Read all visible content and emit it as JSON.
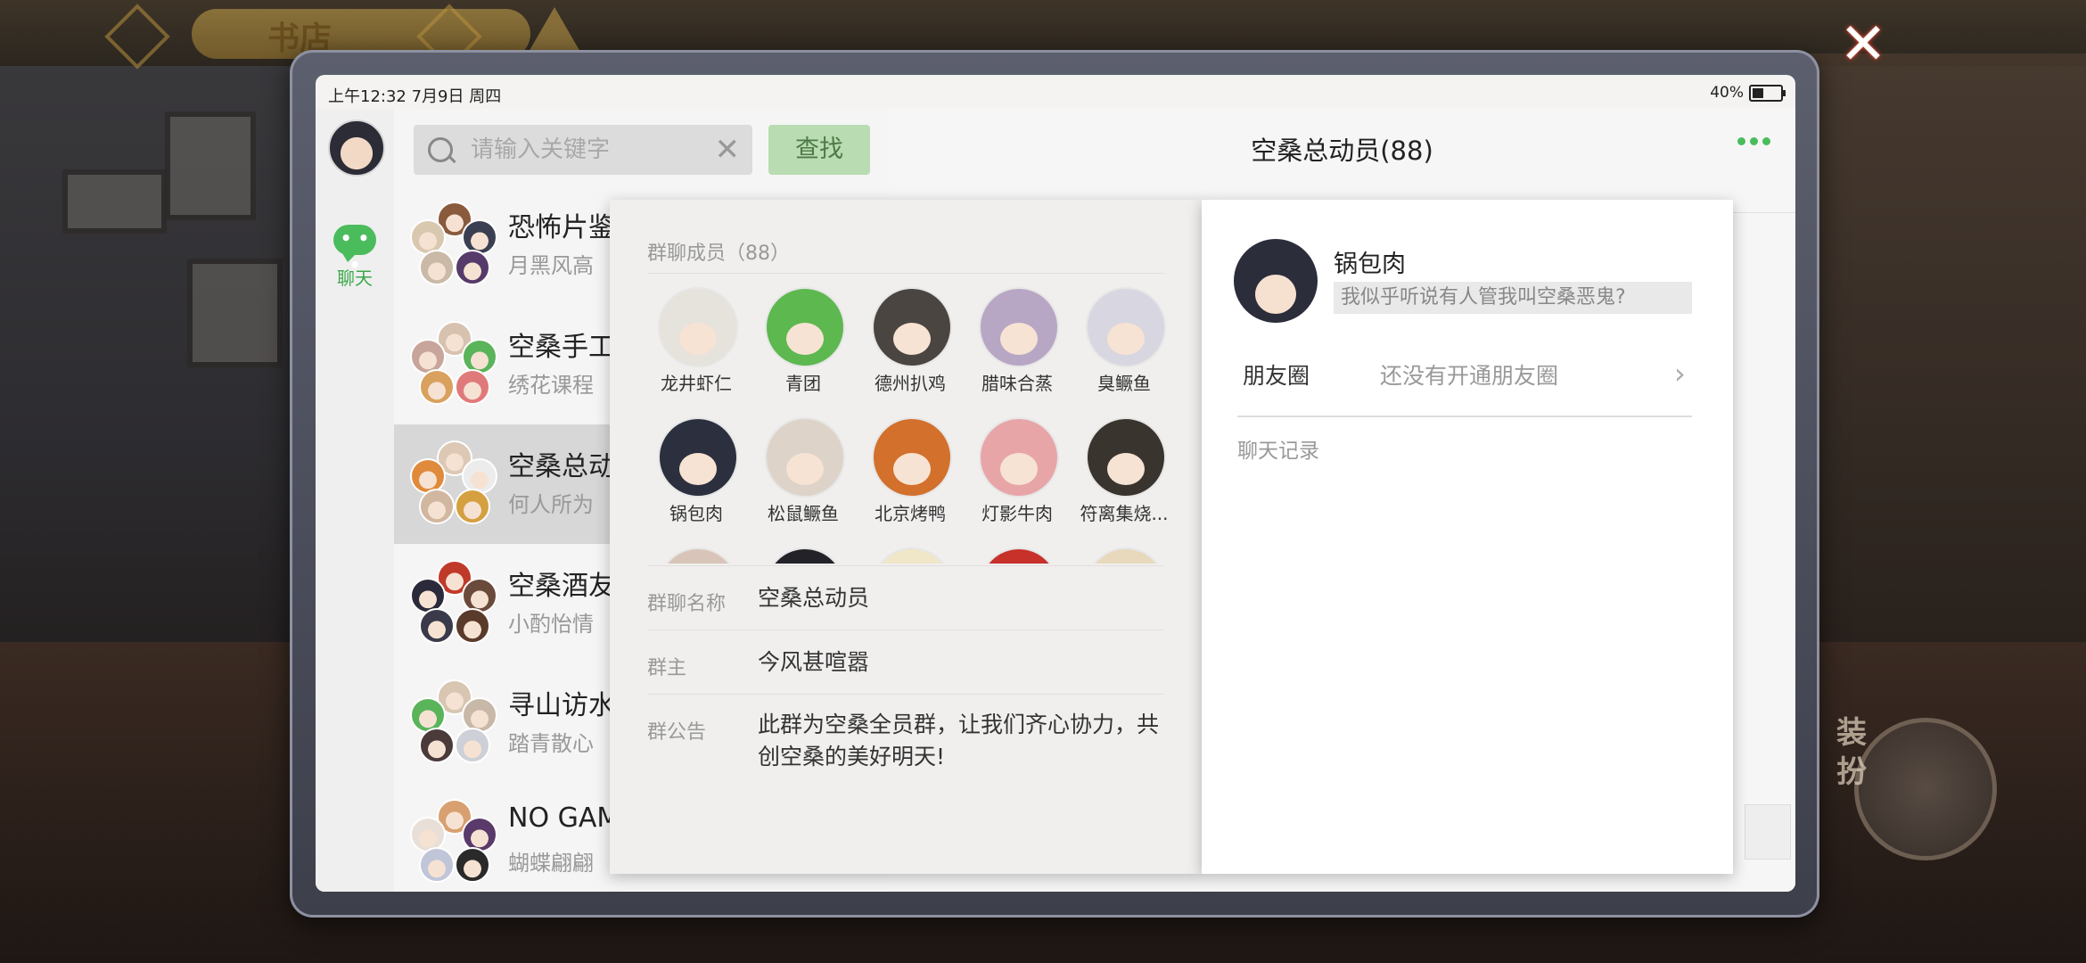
{
  "background": {
    "top_title": "书店",
    "dress_label": "装扮",
    "close_icon": "close-x-icon"
  },
  "status_bar": {
    "time": "上午12:32 7月9日 周四",
    "battery": "40%"
  },
  "rail": {
    "chat_label": "聊天",
    "chat_icon": "speech-bubble-icon"
  },
  "search": {
    "placeholder": "请输入关键字",
    "button": "查找"
  },
  "chat_list": [
    {
      "name": "恐怖片鉴",
      "sub": "月黑风高",
      "colors": [
        "#8a5a3c",
        "#d9c8b0",
        "#3b3f52",
        "#c9b9a6",
        "#553a6a"
      ]
    },
    {
      "name": "空桑手工",
      "sub": "绣花课程",
      "colors": [
        "#d7c2b0",
        "#c8a59b",
        "#5ab45a",
        "#d9a15e",
        "#e07a7a"
      ]
    },
    {
      "name": "空桑总动",
      "sub": "何人所为",
      "colors": [
        "#dcc8b4",
        "#e08a3c",
        "#ececec",
        "#d2b7a0",
        "#d4a040"
      ]
    },
    {
      "name": "空桑酒友",
      "sub": "小酌怡情",
      "colors": [
        "#c03a2a",
        "#2a2a3a",
        "#6a4a3a",
        "#3a3a4a",
        "#5a3a2a"
      ]
    },
    {
      "name": "寻山访水",
      "sub": "踏青散心",
      "colors": [
        "#d8c6b2",
        "#5ab45a",
        "#c8b8a8",
        "#4a3a3a",
        "#ced0d8"
      ]
    },
    {
      "name": "NO GAM",
      "sub": "蝴蝶翩翩",
      "colors": [
        "#d8a070",
        "#e8e0d8",
        "#5a3a6a",
        "#c0c6d8",
        "#2a2a2a"
      ]
    }
  ],
  "chat": {
    "title": "空桑总动员(88)",
    "more_icon": "more-dots-icon"
  },
  "group_info": {
    "members_title": "群聊成员（88）",
    "members": [
      {
        "name": "龙井虾仁",
        "color": "#e6e2dc"
      },
      {
        "name": "青团",
        "color": "#5db84f"
      },
      {
        "name": "德州扒鸡",
        "color": "#4a4540"
      },
      {
        "name": "腊味合蒸",
        "color": "#b7a6c4"
      },
      {
        "name": "臭鳜鱼",
        "color": "#d8d6e0"
      },
      {
        "name": "锅包肉",
        "color": "#2c2f3e"
      },
      {
        "name": "松鼠鳜鱼",
        "color": "#ddd3c8"
      },
      {
        "name": "北京烤鸭",
        "color": "#d2702c"
      },
      {
        "name": "灯影牛肉",
        "color": "#e8a5a8"
      },
      {
        "name": "符离集烧...",
        "color": "#3a342e"
      },
      {
        "name": "",
        "color": "#d8c4b8"
      },
      {
        "name": "",
        "color": "#222228"
      },
      {
        "name": "",
        "color": "#f0e6c8"
      },
      {
        "name": "",
        "color": "#c8302a"
      },
      {
        "name": "",
        "color": "#e8d8bc"
      }
    ],
    "name_label": "群聊名称",
    "name_value": "空桑总动员",
    "owner_label": "群主",
    "owner_value": "今风甚喧嚣",
    "notice_label": "群公告",
    "notice_value": "此群为空桑全员群，让我们齐心协力，共创空桑的美好明天!"
  },
  "profile": {
    "name": "锅包肉",
    "signature": "我似乎听说有人管我叫空桑恶鬼?",
    "moments_label": "朋友圈",
    "moments_value": "还没有开通朋友圈",
    "records_label": "聊天记录",
    "chevron_icon": "chevron-right-icon"
  }
}
